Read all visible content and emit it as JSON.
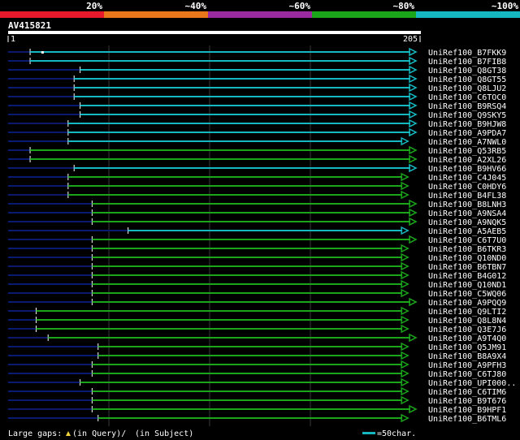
{
  "header": {
    "scale_labels": [
      "20%",
      "~40%",
      "~60%",
      "~80%",
      "~100%"
    ],
    "scale_colors": [
      "#e8192c",
      "#e8761a",
      "#9a2aa0",
      "#1aa51a",
      "#15b8c0"
    ],
    "query_id": "AV415821",
    "ruler_start": "1",
    "ruler_end": "205",
    "query_length": 205
  },
  "colors": {
    "cyan": "#15b8c0",
    "green": "#1aa51a",
    "tail": "#0a1a6e",
    "grid": "#3a3a3a"
  },
  "hits": [
    {
      "name": "UniRef100_B7FKK9",
      "start": 12,
      "end": 205,
      "color": "cyan",
      "tail": true,
      "gap_at": 18
    },
    {
      "name": "UniRef100_B7FIB8",
      "start": 12,
      "end": 205,
      "color": "cyan",
      "tail": true
    },
    {
      "name": "UniRef100_Q8GT38",
      "start": 37,
      "end": 205,
      "color": "cyan",
      "tail": true
    },
    {
      "name": "UniRef100_Q8GT55",
      "start": 34,
      "end": 205,
      "color": "cyan",
      "tail": true
    },
    {
      "name": "UniRef100_Q8LJU2",
      "start": 34,
      "end": 205,
      "color": "cyan",
      "tail": true
    },
    {
      "name": "UniRef100_C6TOC0",
      "start": 34,
      "end": 205,
      "color": "cyan",
      "tail": true
    },
    {
      "name": "UniRef100_B9RSQ4",
      "start": 37,
      "end": 205,
      "color": "cyan",
      "tail": true
    },
    {
      "name": "UniRef100_Q9SKY5",
      "start": 37,
      "end": 205,
      "color": "cyan",
      "tail": true
    },
    {
      "name": "UniRef100_B9HJW8",
      "start": 31,
      "end": 205,
      "color": "cyan",
      "tail": true
    },
    {
      "name": "UniRef100_A9PDA7",
      "start": 31,
      "end": 205,
      "color": "cyan",
      "tail": true
    },
    {
      "name": "UniRef100_A7NWL0",
      "start": 31,
      "end": 201,
      "color": "cyan",
      "tail": true
    },
    {
      "name": "UniRef100_Q53RB5",
      "start": 12,
      "end": 205,
      "color": "green",
      "tail": true
    },
    {
      "name": "UniRef100_A2XL26",
      "start": 12,
      "end": 205,
      "color": "green",
      "tail": true
    },
    {
      "name": "UniRef100_B9HV66",
      "start": 34,
      "end": 205,
      "color": "cyan",
      "tail": true
    },
    {
      "name": "UniRef100_C4J045",
      "start": 31,
      "end": 201,
      "color": "green",
      "tail": true
    },
    {
      "name": "UniRef100_C0HDY6",
      "start": 31,
      "end": 201,
      "color": "green",
      "tail": true
    },
    {
      "name": "UniRef100_B4FL38",
      "start": 31,
      "end": 201,
      "color": "green",
      "tail": true
    },
    {
      "name": "UniRef100_B8LNH3",
      "start": 43,
      "end": 205,
      "color": "green",
      "tail": true
    },
    {
      "name": "UniRef100_A9NSA4",
      "start": 43,
      "end": 205,
      "color": "green",
      "tail": true
    },
    {
      "name": "UniRef100_A9NQK5",
      "start": 43,
      "end": 205,
      "color": "green",
      "tail": true
    },
    {
      "name": "UniRef100_A5AEB5",
      "start": 61,
      "end": 201,
      "color": "cyan",
      "tail": true
    },
    {
      "name": "UniRef100_C6T7U0",
      "start": 43,
      "end": 205,
      "color": "green",
      "tail": true
    },
    {
      "name": "UniRef100_B6TKR3",
      "start": 43,
      "end": 201,
      "color": "green",
      "tail": true
    },
    {
      "name": "UniRef100_Q10ND0",
      "start": 43,
      "end": 201,
      "color": "green",
      "tail": true
    },
    {
      "name": "UniRef100_B6TBN7",
      "start": 43,
      "end": 201,
      "color": "green",
      "tail": true
    },
    {
      "name": "UniRef100_B4G012",
      "start": 43,
      "end": 201,
      "color": "green",
      "tail": true
    },
    {
      "name": "UniRef100_Q10ND1",
      "start": 43,
      "end": 201,
      "color": "green",
      "tail": true
    },
    {
      "name": "UniRef100_C5WQ06",
      "start": 43,
      "end": 201,
      "color": "green",
      "tail": true
    },
    {
      "name": "UniRef100_A9PQQ9",
      "start": 43,
      "end": 205,
      "color": "green",
      "tail": true
    },
    {
      "name": "UniRef100_Q9LTI2",
      "start": 15,
      "end": 201,
      "color": "green",
      "tail": true
    },
    {
      "name": "UniRef100_Q8L8N4",
      "start": 15,
      "end": 201,
      "color": "green",
      "tail": true
    },
    {
      "name": "UniRef100_Q3E7J6",
      "start": 15,
      "end": 201,
      "color": "green",
      "tail": true
    },
    {
      "name": "UniRef100_A9T4Q0",
      "start": 21,
      "end": 205,
      "color": "green",
      "tail": true
    },
    {
      "name": "UniRef100_Q5JM91",
      "start": 46,
      "end": 201,
      "color": "green",
      "tail": true
    },
    {
      "name": "UniRef100_B8A9X4",
      "start": 46,
      "end": 201,
      "color": "green",
      "tail": true
    },
    {
      "name": "UniRef100_A9PFH3",
      "start": 43,
      "end": 201,
      "color": "green",
      "tail": true
    },
    {
      "name": "UniRef100_C6TJ80",
      "start": 43,
      "end": 201,
      "color": "green",
      "tail": true
    },
    {
      "name": "UniRef100_UPI000..",
      "start": 37,
      "end": 201,
      "color": "green",
      "tail": true
    },
    {
      "name": "UniRef100_C6TIM6",
      "start": 43,
      "end": 201,
      "color": "green",
      "tail": true
    },
    {
      "name": "UniRef100_B9T676",
      "start": 43,
      "end": 201,
      "color": "green",
      "tail": true
    },
    {
      "name": "UniRef100_B9HPF1",
      "start": 43,
      "end": 205,
      "color": "green",
      "tail": true
    },
    {
      "name": "UniRef100_B6TML6",
      "start": 46,
      "end": 201,
      "color": "green",
      "tail": true
    }
  ],
  "footer": {
    "legend_prefix": "Large gaps:",
    "gap_query": "(in Query)/",
    "gap_subject": "(in Subject)",
    "scale_label": "=50char."
  }
}
